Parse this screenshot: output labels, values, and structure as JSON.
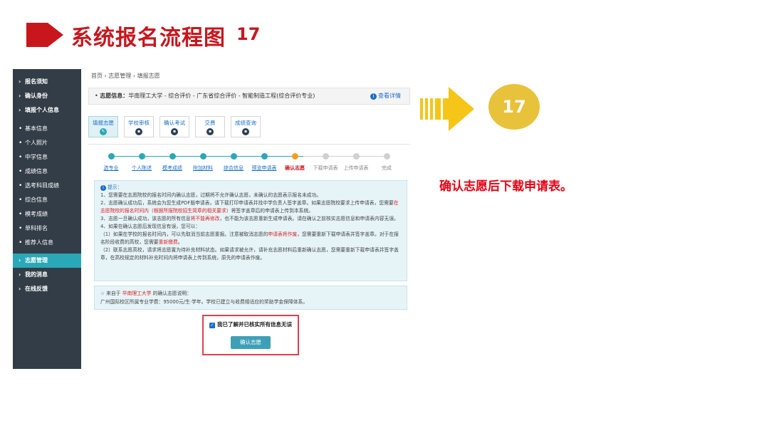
{
  "slide": {
    "title": "系统报名流程图",
    "number": "17",
    "caption": "确认志愿后下载申请表。",
    "step_badge": "17"
  },
  "sidebar": {
    "items": [
      {
        "label": "报名须知",
        "type": "parent"
      },
      {
        "label": "确认身份",
        "type": "parent"
      },
      {
        "label": "填报个人信息",
        "type": "parent"
      },
      {
        "label": "基本信息",
        "type": "child"
      },
      {
        "label": "个人照片",
        "type": "child"
      },
      {
        "label": "中学信息",
        "type": "child"
      },
      {
        "label": "成绩信息",
        "type": "child"
      },
      {
        "label": "选考科目成绩",
        "type": "child"
      },
      {
        "label": "综合信息",
        "type": "child"
      },
      {
        "label": "模考成绩",
        "type": "child"
      },
      {
        "label": "单科排名",
        "type": "child"
      },
      {
        "label": "推荐人信息",
        "type": "child"
      },
      {
        "label": "志愿管理",
        "type": "parent",
        "active": true
      },
      {
        "label": "我的消息",
        "type": "parent"
      },
      {
        "label": "在线反馈",
        "type": "parent"
      }
    ]
  },
  "main": {
    "breadcrumb": "首页 › 志愿管理 › 填报志愿",
    "info_label": "志愿信息：",
    "info_value": "华南理工大学 - 综合评价 - 广东省综合评价 - 智能制造工程(综合评价专业)",
    "view_detail": "查看详情",
    "tabs": [
      "填报志愿",
      "学校审核",
      "确认考试",
      "交费",
      "成绩查询"
    ],
    "steps": [
      "选专业",
      "个人陈述",
      "模考成绩",
      "附加材料",
      "综合信息",
      "预览申请表",
      "确认志愿",
      "下载申请表",
      "上传申请表",
      "完成"
    ],
    "current_step": 6,
    "notice": {
      "hint": "提示：",
      "line1": "1、您需要在志愿院校的报名时间内确认志愿，过期将不允许确认志愿，未确认的志愿表示报名未成功。",
      "line2a": "2、志愿确认成功后，系统会为您生成PDF版申请表，请下载打印申请表并找中学负责人签字盖章。如果志愿院校要求上传申请表，您需要",
      "line2b": "在志愿院校的报名时间内（根据所报院校招生简章的相关要求）",
      "line2c": "将签字盖章后的申请表上传到本系统。",
      "line3a": "3、志愿一旦确认成功，该志愿的所有信息",
      "line3b": "将不能再修改",
      "line3c": "，也不能为该志愿重新生成申请表。请在确认之前核实志愿信息和申请表内容无误。",
      "line4": "4、如果在确认志愿后发现信息有误，您可以：",
      "line5a": "（1）如果在学校的报名时间内，可以先取消当前志愿重报。注意被取消志愿的",
      "line5b": "申请表将作废",
      "line5c": "，您需要重新下载申请表并签字盖章。对于在报名阶段收费的高校，您需要",
      "line5d": "重新缴费",
      "line5e": "。",
      "line6": "（2）联系志愿高校，请求将志愿置为待补充材料状态。如果请求被允许，请补充志愿材料后重新确认志愿，您需要重新下载申请表并签字盖章，在高校规定的材料补充时间内将申请表上传到系统，原先的申请表作废。"
    },
    "source": {
      "prefix": "来自于",
      "school": "华南理工大学",
      "suffix": "的确认志愿说明：",
      "text": "广州国际校区所属专业学费：95000元/生·学年。学校已建立与收费相适应的奖助学金保障体系。"
    },
    "confirm_checkbox": "我已了解并已核实所有信息无误",
    "confirm_button": "确认志愿"
  },
  "colors": {
    "title_red": "#c8161d",
    "sidebar_bg": "#333d47",
    "accent_teal": "#2aa8b8",
    "arrow_yellow": "#f5c518",
    "badge_gold": "#e8c23a",
    "caption_red": "#e60012"
  },
  "icons": [
    "triangle-arrow-icon",
    "info-icon",
    "star-icon",
    "checkbox-icon",
    "bold-arrow-icon"
  ]
}
